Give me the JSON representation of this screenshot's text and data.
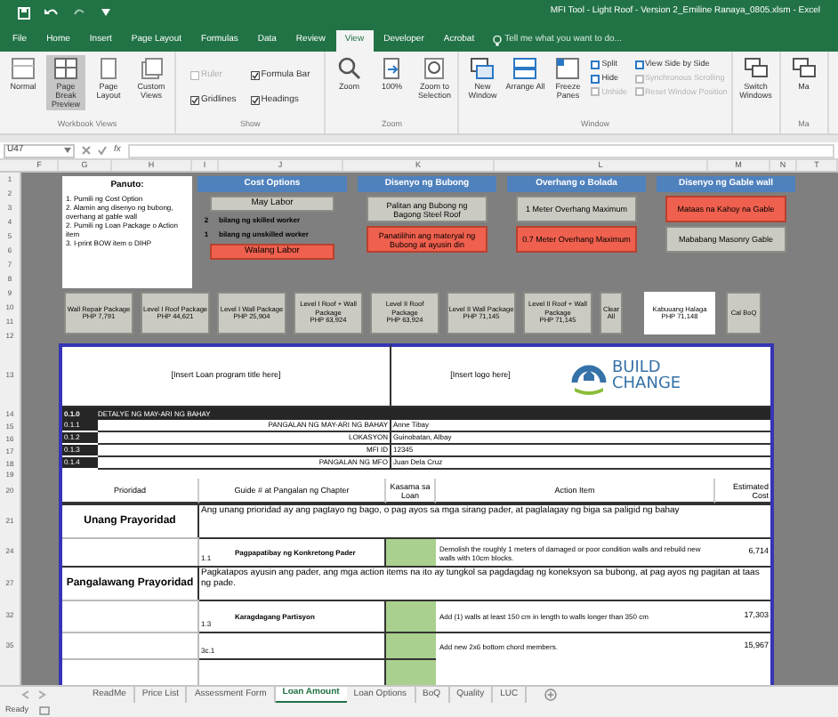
{
  "title_bar": {
    "title": "MFI Tool - Light Roof - Version 2_Emiline Ranaya_0805.xlsm - Excel"
  },
  "ribbon_tabs": [
    {
      "label": "File",
      "selected": false
    },
    {
      "label": "Home",
      "selected": false
    },
    {
      "label": "Insert",
      "selected": false
    },
    {
      "label": "Page Layout",
      "selected": false
    },
    {
      "label": "Formulas",
      "selected": false
    },
    {
      "label": "Data",
      "selected": false
    },
    {
      "label": "Review",
      "selected": false
    },
    {
      "label": "View",
      "selected": true
    },
    {
      "label": "Developer",
      "selected": false
    },
    {
      "label": "Acrobat",
      "selected": false
    }
  ],
  "tell_me": "Tell me what you want to do...",
  "ribbon_groups": [
    {
      "label": "Workbook Views",
      "items": [
        {
          "kind": "big",
          "label": "Normal",
          "selected": false
        },
        {
          "kind": "big",
          "label": "Page Break Preview",
          "selected": true
        },
        {
          "kind": "big",
          "label": "Page Layout",
          "selected": false
        },
        {
          "kind": "big",
          "label": "Custom Views",
          "selected": false
        }
      ]
    },
    {
      "label": "Show",
      "items": [
        {
          "kind": "check",
          "label": "Ruler",
          "checked": false,
          "disabled": true
        },
        {
          "kind": "check",
          "label": "Gridlines",
          "checked": true,
          "disabled": false
        },
        {
          "kind": "check",
          "label": "Formula Bar",
          "checked": true,
          "disabled": false
        },
        {
          "kind": "check",
          "label": "Headings",
          "checked": true,
          "disabled": false
        }
      ]
    },
    {
      "label": "Zoom",
      "items": [
        {
          "kind": "big",
          "label": "Zoom",
          "selected": false
        },
        {
          "kind": "big",
          "label": "100%",
          "selected": false
        },
        {
          "kind": "big",
          "label": "Zoom to Selection",
          "selected": false
        }
      ]
    },
    {
      "label": "Window",
      "items": [
        {
          "kind": "big",
          "label": "New Window",
          "selected": false
        },
        {
          "kind": "big",
          "label": "Arrange All",
          "selected": false
        },
        {
          "kind": "big",
          "label": "Freeze Panes",
          "selected": false
        },
        {
          "kind": "small",
          "label": "Split",
          "disabled": false
        },
        {
          "kind": "small",
          "label": "Hide",
          "disabled": false
        },
        {
          "kind": "small",
          "label": "Unhide",
          "disabled": true
        },
        {
          "kind": "small",
          "label": "View Side by Side",
          "disabled": false
        },
        {
          "kind": "small",
          "label": "Synchronous Scrolling",
          "disabled": true
        },
        {
          "kind": "small",
          "label": "Reset Window Position",
          "disabled": true
        }
      ]
    },
    {
      "items": [
        {
          "kind": "big",
          "label": "Switch Windows",
          "selected": false
        }
      ]
    },
    {
      "label": "Ma",
      "items": [
        {
          "kind": "big",
          "label": "Ma",
          "selected": false
        }
      ]
    }
  ],
  "formula_bar": {
    "name_box": "U47",
    "function_label": "fx"
  },
  "column_headers": [
    "F",
    "G",
    "H",
    "I",
    "J",
    "K",
    "L",
    "M",
    "N",
    "T"
  ],
  "row_numbers": [
    "1",
    "2",
    "3",
    "4",
    "5",
    "6",
    "7",
    "8",
    "9",
    "10",
    "11",
    "12",
    "13",
    "14",
    "15",
    "16",
    "17",
    "18",
    "19",
    "20",
    "21",
    "24",
    "27",
    "32",
    "35"
  ],
  "instructions": {
    "title": "Panuto:",
    "lines": [
      "1. Pumili ng Cost Option",
      "2. Alamin ang disenyo ng bubong, overhang at gable wall",
      "2. Pumili ng Loan Package o Action item",
      "3. I-print BOW item o DIHP"
    ]
  },
  "cost_options": {
    "title": "Cost Options",
    "with_labor": {
      "label": "May Labor",
      "selected": false
    },
    "workers": [
      {
        "count": "2",
        "label": "bilang ng skilled worker"
      },
      {
        "count": "1",
        "label": "bilang ng unskilled worker"
      }
    ],
    "without_labor": {
      "label": "Walang Labor",
      "selected": true
    }
  },
  "option_panels": [
    {
      "title": "Disenyo ng Bubong",
      "options": [
        {
          "label": "Palitan ang Bubong ng Bagong Steel Roof",
          "selected": false
        },
        {
          "label": "Panatilihin ang materyal ng Bubong at ayusin din",
          "selected": true
        }
      ]
    },
    {
      "title": "Overhang o Bolada",
      "options": [
        {
          "label": "1 Meter Overhang Maximum",
          "selected": false
        },
        {
          "label": "0.7 Meter Overhang Maximum",
          "selected": true
        }
      ]
    },
    {
      "title": "Disenyo ng Gable wall",
      "options": [
        {
          "label": "Mataas na Kahoy na Gable",
          "selected": true
        },
        {
          "label": "Mababang Masonry Gable",
          "selected": false
        }
      ]
    }
  ],
  "packages": [
    {
      "label": "Wall Repair Package",
      "price": "PHP 7,791"
    },
    {
      "label": "Level I Roof Package",
      "price": "PHP 44,621"
    },
    {
      "label": "Level I Wall Package",
      "price": "PHP 25,904"
    },
    {
      "label": "Level I Roof + Wall Package",
      "price": "PHP 63,924"
    },
    {
      "label": "Level II Roof Package",
      "price": "PHP 63,924"
    },
    {
      "label": "Level II Wall Package",
      "price": "PHP 71,145"
    },
    {
      "label": "Level II Roof + Wall Package",
      "price": "PHP 71,145"
    }
  ],
  "clear_all": "Clear All",
  "total": {
    "label": "Kabuuang Halaga",
    "value": "PHP 71,148"
  },
  "calc_boq": "Cal BoQ",
  "form": {
    "title_placeholder": "[Insert Loan program title here]",
    "logo_placeholder": "[Insert logo here]",
    "logo": {
      "line1": "BUILD",
      "line2": "CHANGE"
    },
    "details_header": {
      "code": "0.1.0",
      "label": "DETALYE NG MAY-ARI NG BAHAY"
    },
    "details": [
      {
        "code": "0.1.1",
        "label": "PANGALAN NG MAY-ARI NG BAHAY",
        "value": "Anne Tibay"
      },
      {
        "code": "0.1.2",
        "label": "LOKASYON",
        "value": "Guinobatan, Albay"
      },
      {
        "code": "0.1.3",
        "label": "MFI ID",
        "value": "12345"
      },
      {
        "code": "0.1.4",
        "label": "PANGALAN NG MFO",
        "value": "Juan Dela Cruz"
      }
    ],
    "columns": [
      "Prioridad",
      "Guide # at Pangalan ng Chapter",
      "Kasama sa Loan",
      "Action Item",
      "Estimated Cost"
    ],
    "priorities": [
      {
        "label": "Unang Prayoridad",
        "description": "Ang unang prioridad ay ang pagtayo ng bago, o pag ayos sa mga sirang pader, at paglalagay ng biga sa paligid ng bahay",
        "items": [
          {
            "guide": "1.1",
            "chapter": "Pagpapatibay ng Konkretong Pader",
            "included": true,
            "action": "Demolish the roughly 1 meters of damaged or poor condition walls and rebuild new walls with 10cm blocks.",
            "cost": "6,714"
          }
        ]
      },
      {
        "label": "Pangalawang Prayoridad",
        "description": "Pagkatapos ayusin ang pader, ang mga action items na ito ay tungkol sa pagdagdag ng koneksyon sa bubong, at pag ayos ng pagitan at taas ng pade.",
        "items": [
          {
            "guide": "1.3",
            "chapter": "Karagdagang Partisyon",
            "included": true,
            "action": "Add (1) walls at least 150 cm in length to walls longer than 350 cm",
            "cost": "17,303"
          },
          {
            "guide": "3c.1",
            "included": true,
            "action": "Add new 2x6 bottom chord members.",
            "cost": "15,967"
          }
        ]
      }
    ]
  },
  "sheet_tabs": [
    {
      "label": "ReadMe",
      "selected": false
    },
    {
      "label": "Price List",
      "selected": false
    },
    {
      "label": "Assessment Form",
      "selected": false
    },
    {
      "label": "Loan Amount",
      "selected": true
    },
    {
      "label": "Loan Options",
      "selected": false
    },
    {
      "label": "BoQ",
      "selected": false
    },
    {
      "label": "Quality",
      "selected": false
    },
    {
      "label": "LUC",
      "selected": false
    }
  ],
  "status": "Ready"
}
